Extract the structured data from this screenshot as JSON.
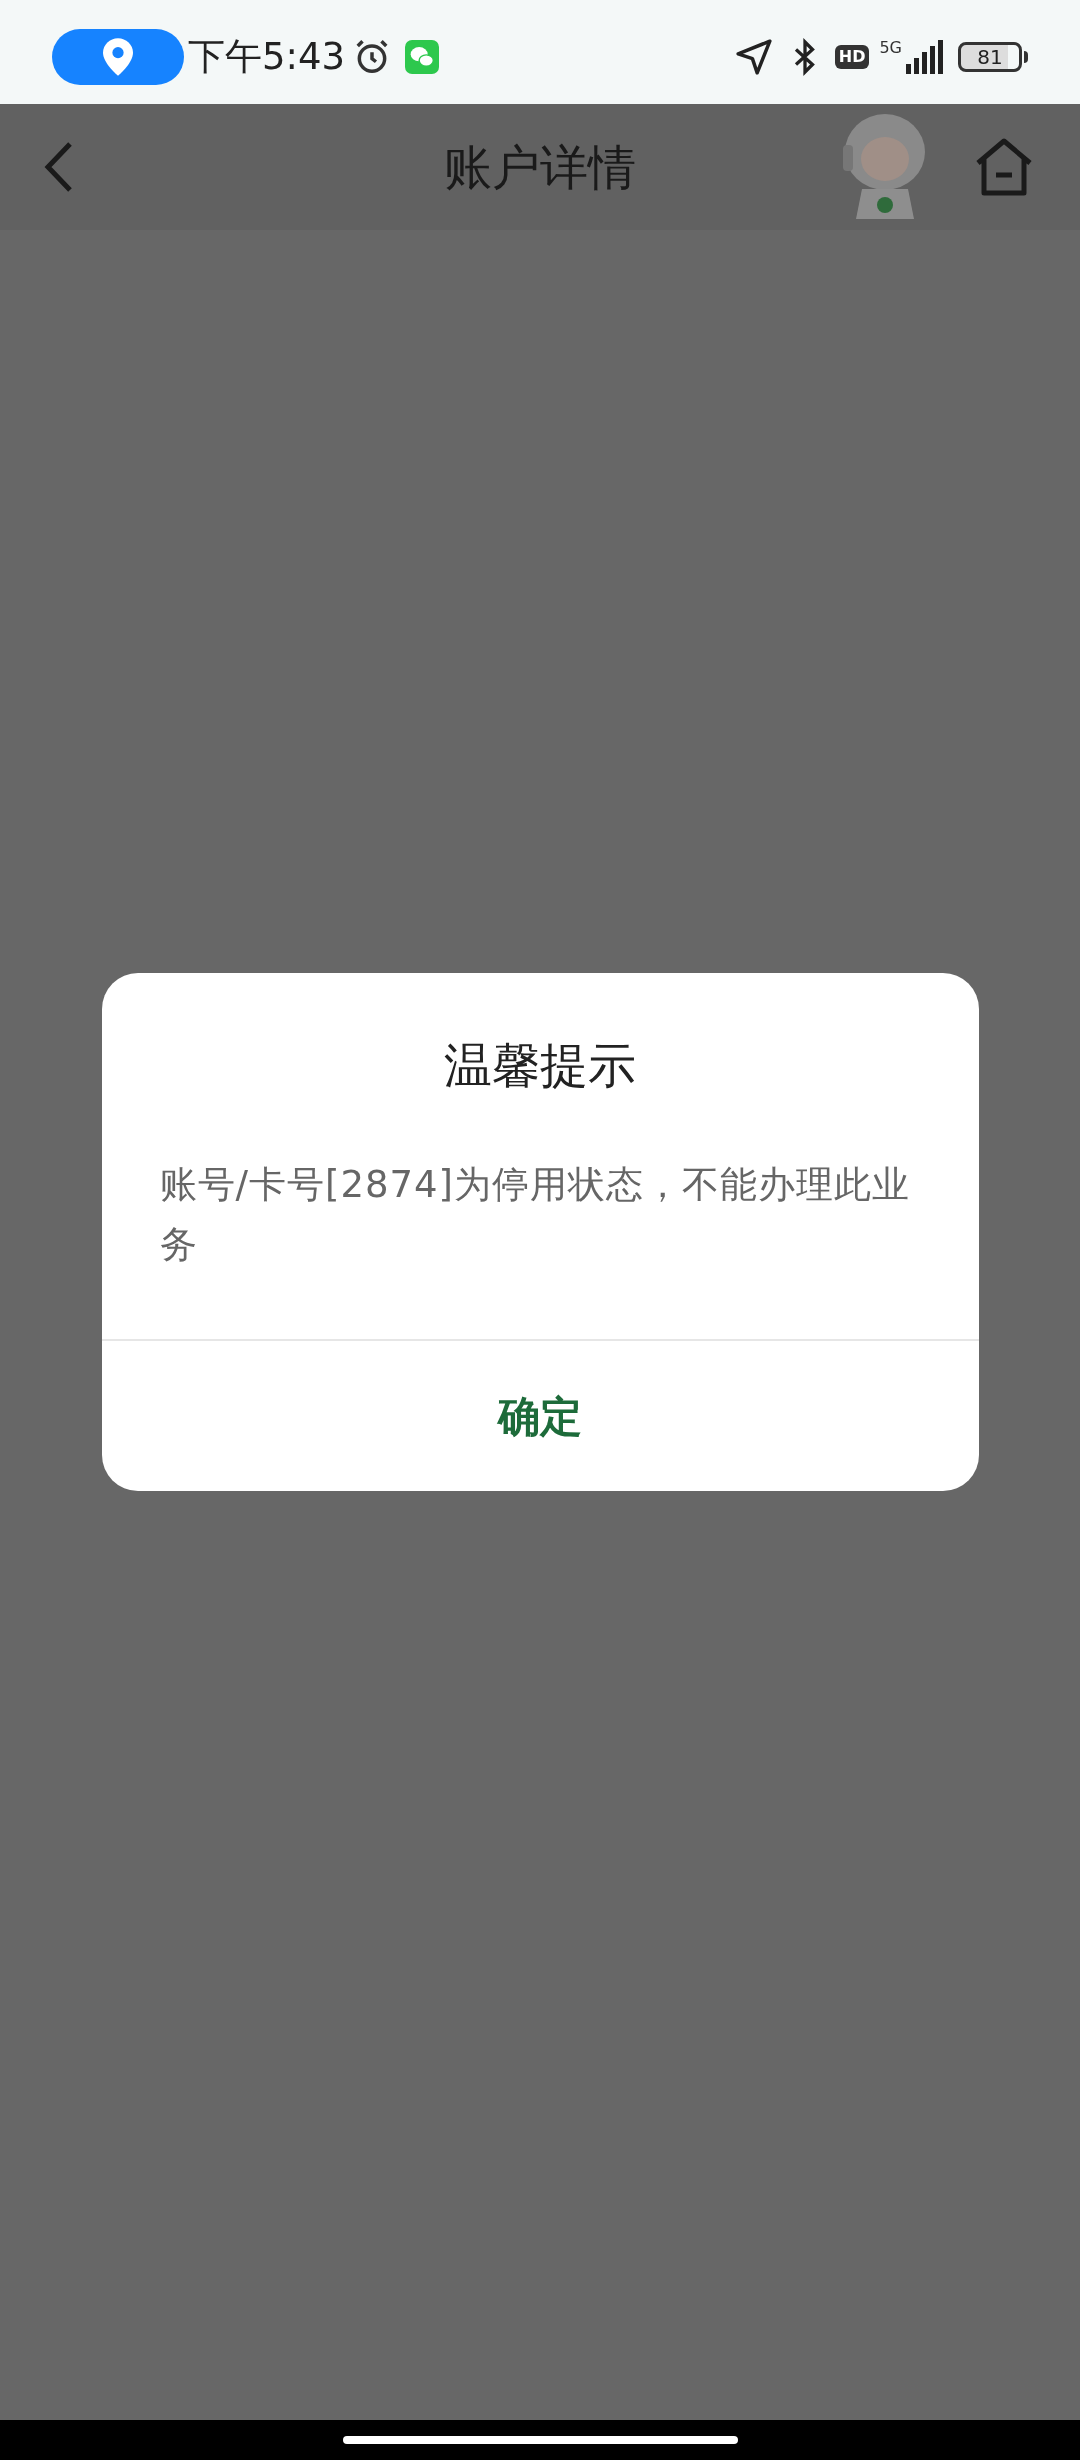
{
  "status_bar": {
    "time": "下午5:43",
    "hd_badge": "HD",
    "network": "5G",
    "battery": "81"
  },
  "header": {
    "title": "账户详情"
  },
  "dialog": {
    "title": "温馨提示",
    "message": "账号/卡号[2874]为停用状态，不能办理此业务",
    "buttons": [
      "确定"
    ]
  }
}
